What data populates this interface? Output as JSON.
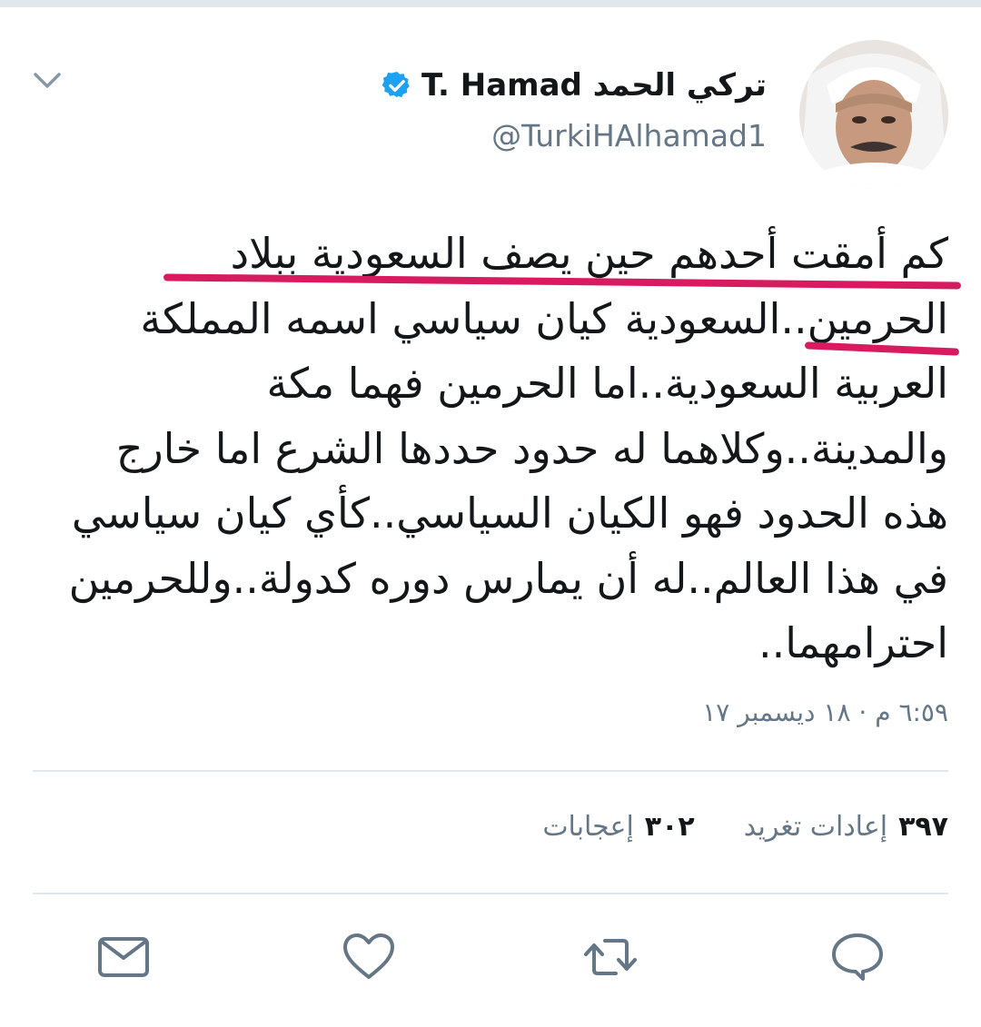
{
  "tweet": {
    "author": {
      "display_name": "تركي الحمد T. Hamad",
      "handle": "@TurkiHAlhamad1",
      "verified": true
    },
    "text_lines": [
      "كم أمقت أحدهم حين يصف السعودية ببلاد",
      "الحرمين..السعودية كيان سياسي اسمه المملكة",
      "العربية السعودية..اما الحرمين فهما مكة",
      "والمدينة..وكلاهما له حدود حددها الشرع اما خارج",
      "هذه الحدود فهو الكيان السياسي..كأي كيان سياسي",
      "في هذا العالم..له أن يمارس دوره كدولة..وللحرمين",
      "احترامهما.."
    ],
    "timestamp": "٦:٥٩ م · ١٨ ديسمبر ١٧",
    "stats": {
      "retweets_count": "٣٩٧",
      "retweets_label": "إعادات تغريد",
      "likes_count": "٣٠٢",
      "likes_label": "إعجابات"
    }
  },
  "icons": {
    "menu": "chevron-down-icon",
    "verified": "verified-badge-icon",
    "actions": [
      "message-icon",
      "heart-icon",
      "retweet-icon",
      "reply-icon"
    ]
  },
  "colors": {
    "text": "#14171a",
    "secondary": "#657786",
    "verified": "#1da1f2",
    "divider": "#e1e8ed",
    "highlight": "#d81b60"
  }
}
